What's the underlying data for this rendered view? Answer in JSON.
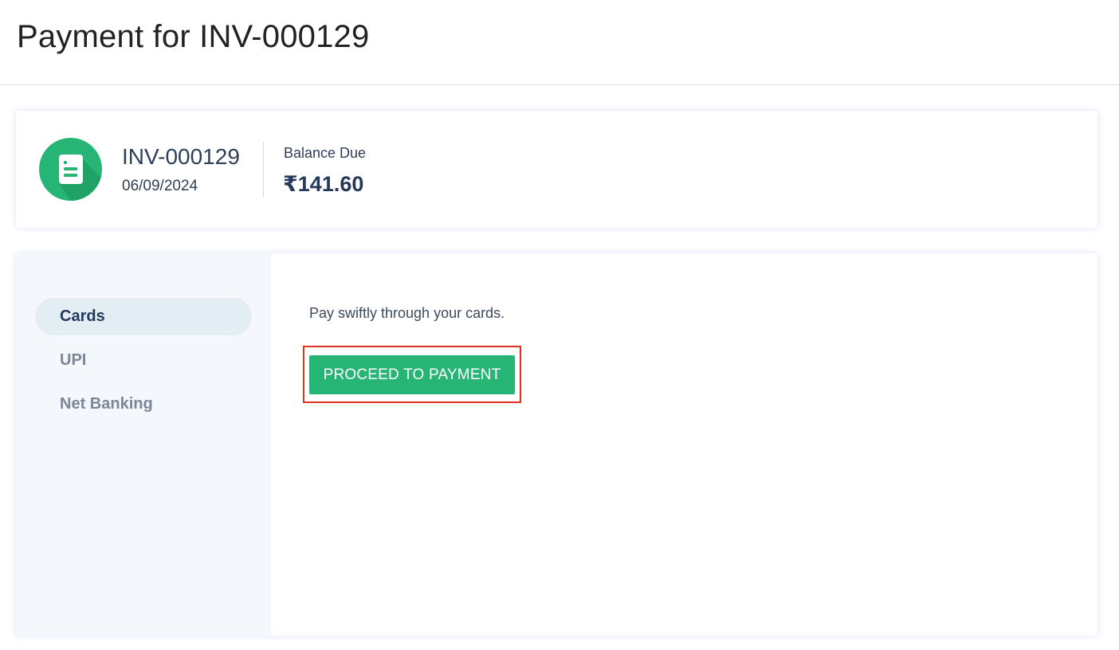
{
  "page": {
    "title": "Payment for INV-000129"
  },
  "invoice": {
    "icon": "invoice-document-icon",
    "number": "INV-000129",
    "date": "06/09/2024",
    "balance_label": "Balance Due",
    "balance_amount": "₹141.60"
  },
  "payment_methods": {
    "items": [
      {
        "label": "Cards",
        "active": true
      },
      {
        "label": "UPI",
        "active": false
      },
      {
        "label": "Net Banking",
        "active": false
      }
    ],
    "selected_description": "Pay swiftly through your cards.",
    "proceed_label": "PROCEED TO PAYMENT"
  },
  "colors": {
    "brand_green": "#26b574",
    "heading_navy": "#24395a",
    "highlight_red": "#e0301e",
    "sidebar_bg": "#f4f7fb",
    "active_pill_bg": "#e3edf4"
  }
}
